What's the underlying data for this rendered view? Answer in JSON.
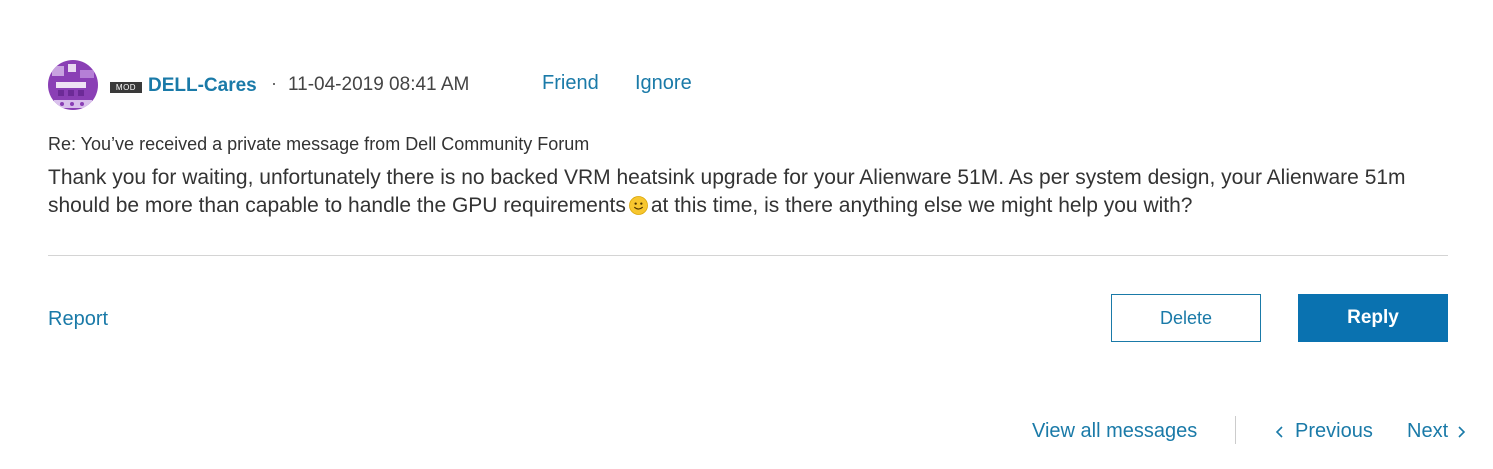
{
  "post": {
    "author": "DELL-Cares",
    "badge": "MOD",
    "timestamp": "11-04-2019 08:41 AM",
    "separator": "·",
    "friend_label": "Friend",
    "ignore_label": "Ignore",
    "subject": "Re: You’ve received a private message from Dell Community Forum",
    "body_part1": "Thank you for waiting, unfortunately there is no backed VRM heatsink upgrade for your Alienware 51M. As per system design, your Alienware 51m should be more than capable to handle the GPU requirements",
    "body_part2": "at this time, is there anything else we might help you with?"
  },
  "actions": {
    "report_label": "Report",
    "delete_label": "Delete",
    "reply_label": "Reply"
  },
  "navigation": {
    "view_all_label": "View all messages",
    "previous_label": "Previous",
    "next_label": "Next"
  },
  "icons": {
    "avatar": "avatar-image",
    "emoji": "smile-emoji-icon",
    "previous": "chevron-left-icon",
    "next": "chevron-right-icon"
  },
  "colors": {
    "link": "#1a7aa8",
    "primary_button": "#0a72b0",
    "avatar_bg": "#8a3fb5"
  }
}
